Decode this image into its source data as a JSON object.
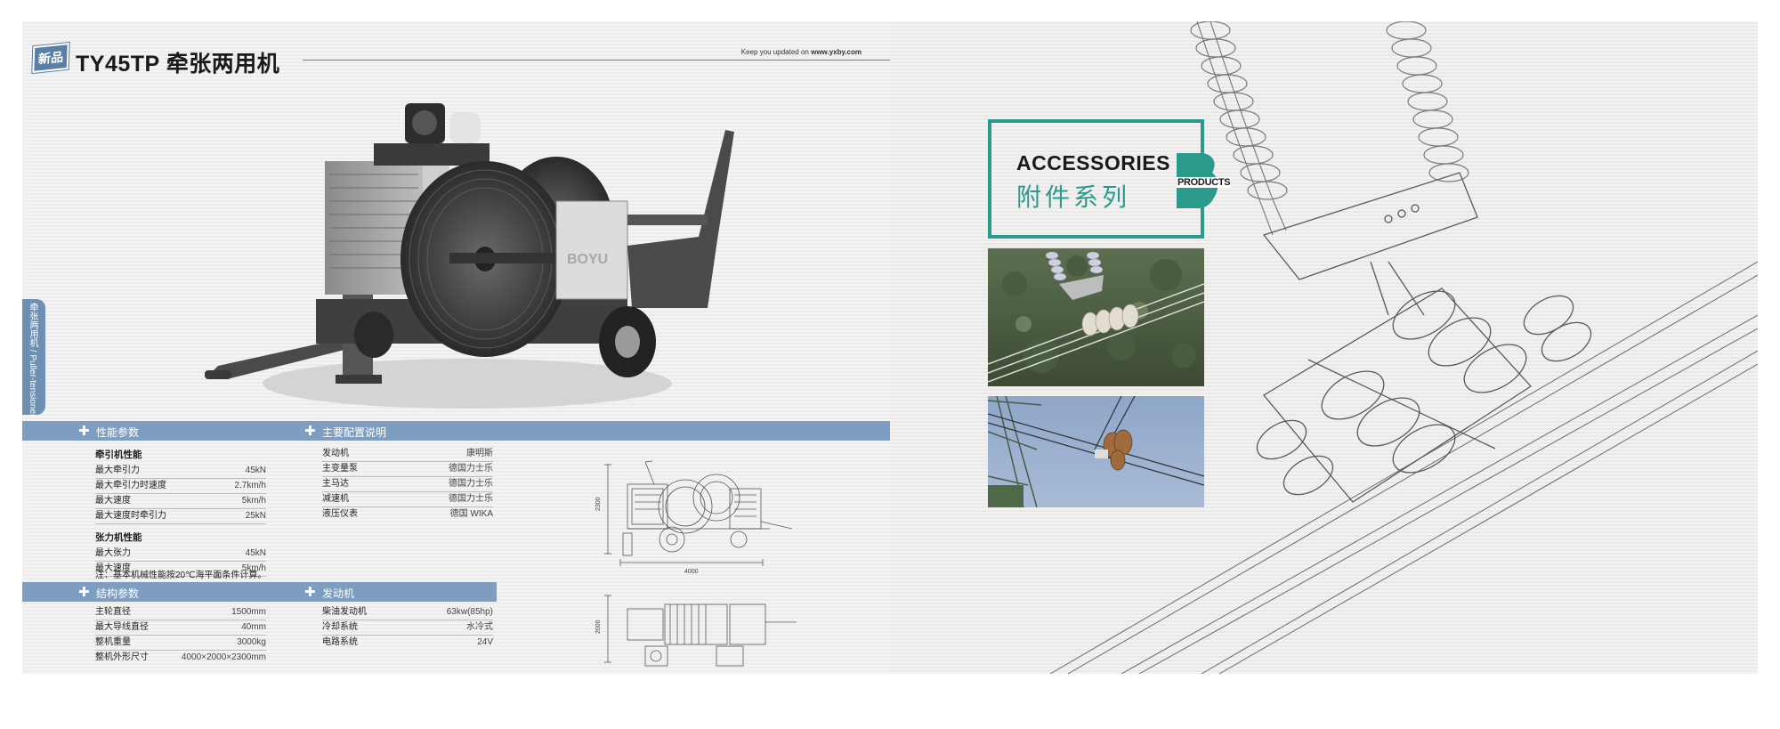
{
  "left_page": {
    "badge": "新品",
    "title": "TY45TP 牵张两用机",
    "site_prefix": "Keep you updated on",
    "site_url": "www.yxby.com",
    "side_tab": "牵张两用机 / Puller-tensioner",
    "machine_brand": "BOYU",
    "sections": {
      "performance": {
        "header": "性能参数",
        "groups": [
          {
            "title": "牵引机性能",
            "rows": [
              {
                "label": "最大牵引力",
                "value": "45kN"
              },
              {
                "label": "最大牵引力时速度",
                "value": "2.7km/h"
              },
              {
                "label": "最大速度",
                "value": "5km/h"
              },
              {
                "label": "最大速度时牵引力",
                "value": "25kN"
              }
            ]
          },
          {
            "title": "张力机性能",
            "rows": [
              {
                "label": "最大张力",
                "value": "45kN"
              },
              {
                "label": "最大速度",
                "value": "5km/h"
              }
            ]
          }
        ],
        "note": "注：基本机械性能按20℃海平面条件计算。"
      },
      "main_config": {
        "header": "主要配置说明",
        "rows": [
          {
            "label": "发动机",
            "value": "康明斯"
          },
          {
            "label": "主变量泵",
            "value": "德国力士乐"
          },
          {
            "label": "主马达",
            "value": "德国力士乐"
          },
          {
            "label": "减速机",
            "value": "德国力士乐"
          },
          {
            "label": "液压仪表",
            "value": "德国 WIKA"
          }
        ]
      },
      "structure": {
        "header": "结构参数",
        "rows": [
          {
            "label": "主轮直径",
            "value": "1500mm"
          },
          {
            "label": "最大导线直径",
            "value": "40mm"
          },
          {
            "label": "整机重量",
            "value": "3000kg"
          },
          {
            "label": "整机外形尺寸",
            "value": "4000×2000×2300mm"
          }
        ]
      },
      "engine": {
        "header": "发动机",
        "rows": [
          {
            "label": "柴油发动机",
            "value": "63kw(85hp)"
          },
          {
            "label": "冷却系统",
            "value": "水冷式"
          },
          {
            "label": "电路系统",
            "value": "24V"
          }
        ]
      }
    },
    "drawing_dims": {
      "side_height": "2300",
      "side_length": "4000",
      "top_width": "2000"
    }
  },
  "right_page": {
    "heading_en": "ACCESSORIES",
    "heading_cn": "附件系列",
    "badge_letter": "B",
    "badge_word": "PRODUCTS"
  },
  "colors": {
    "band_blue": "#7e9ec1",
    "accent_teal": "#2a9a8a",
    "title_rule": "#5a86b3"
  }
}
